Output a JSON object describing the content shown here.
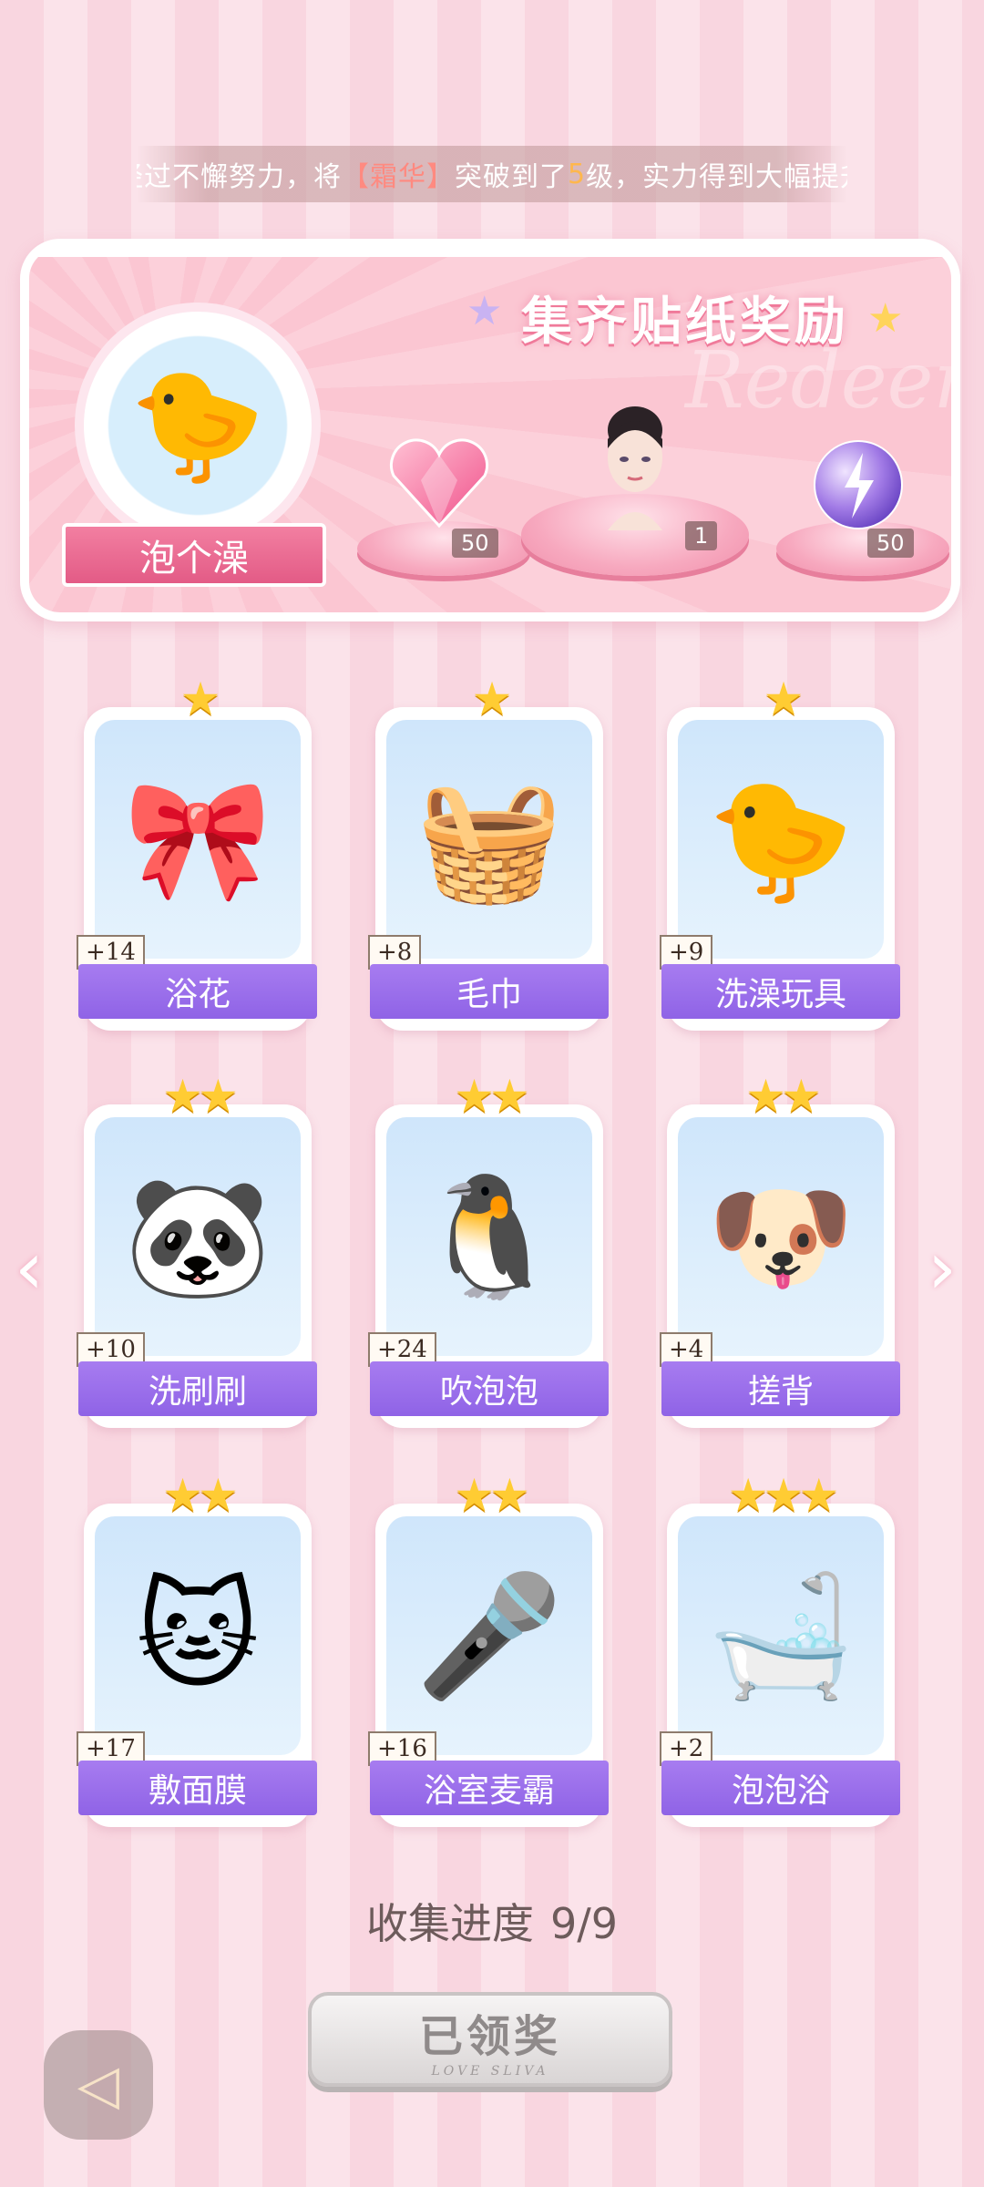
{
  "marquee": {
    "prefix": "经过不懈努力，将",
    "bracket_open": "【",
    "name": "霜华",
    "bracket_close": "】",
    "mid": "突破到了",
    "level": "5",
    "suffix": "级，实力得到大幅提升"
  },
  "banner": {
    "title": "集齐贴纸奖励",
    "watermark": "Redeem",
    "theme_label": "泡个澡",
    "rewards": [
      {
        "icon": "pink-heart-gem-icon",
        "count": "50"
      },
      {
        "icon": "character-portrait-icon",
        "count": "1"
      },
      {
        "icon": "energy-orb-icon",
        "count": "50"
      }
    ]
  },
  "cards": [
    {
      "name": "浴花",
      "points": "+14",
      "stars": "★",
      "icon": "bath-pouf-icon"
    },
    {
      "name": "毛巾",
      "points": "+8",
      "stars": "★",
      "icon": "towel-icon"
    },
    {
      "name": "洗澡玩具",
      "points": "+9",
      "stars": "★",
      "icon": "rubber-duck-icon"
    },
    {
      "name": "洗刷刷",
      "points": "+10",
      "stars": "★★",
      "icon": "panda-scrubbing-icon"
    },
    {
      "name": "吹泡泡",
      "points": "+24",
      "stars": "★★",
      "icon": "penguin-bubble-icon"
    },
    {
      "name": "搓背",
      "points": "+4",
      "stars": "★★",
      "icon": "puppy-bath-icon"
    },
    {
      "name": "敷面膜",
      "points": "+17",
      "stars": "★★",
      "icon": "cat-facemask-icon"
    },
    {
      "name": "浴室麦霸",
      "points": "+16",
      "stars": "★★",
      "icon": "dog-singing-shower-icon"
    },
    {
      "name": "泡泡浴",
      "points": "+2",
      "stars": "★★★",
      "icon": "girl-bubble-bath-icon"
    }
  ],
  "progress": {
    "label": "收集进度",
    "value": "9/9"
  },
  "claim_button": {
    "label": "已领奖",
    "sub": "LOVE SLIVA"
  },
  "colors": {
    "accent_purple": "#9b6cec",
    "pink": "#f27fa1",
    "star": "#ffcc33"
  }
}
